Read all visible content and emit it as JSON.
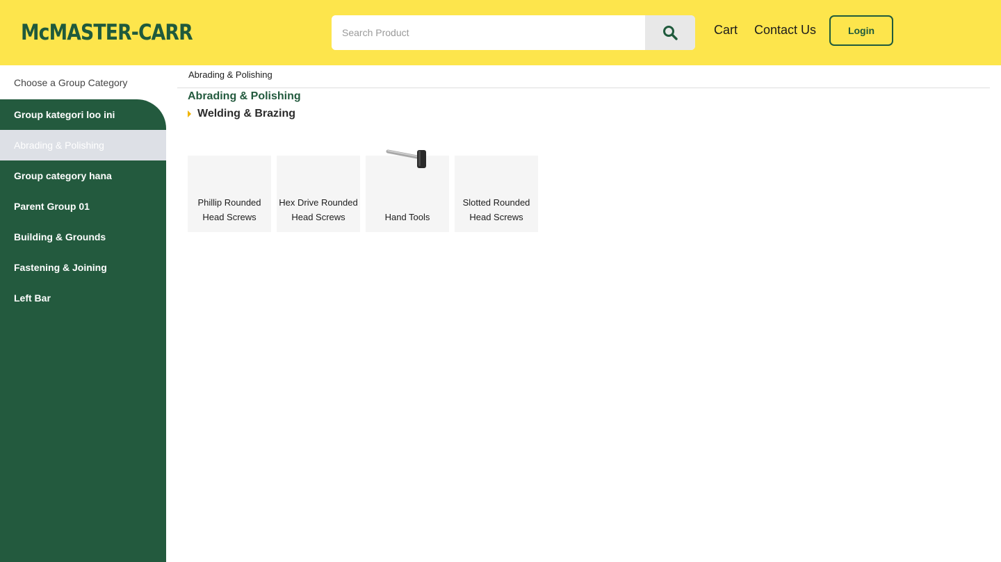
{
  "header": {
    "logo": "McMASTER-CARR",
    "search_placeholder": "Search Product",
    "search_icon": "search-icon",
    "cart_label": "Cart",
    "contact_label": "Contact Us",
    "login_label": "Login"
  },
  "sidebar": {
    "title": "Choose a Group Category",
    "items": [
      {
        "label": "Group kategori loo ini"
      },
      {
        "label": "Abrading & Polishing",
        "active": true
      },
      {
        "label": "Group category hana"
      },
      {
        "label": "Parent Group 01"
      },
      {
        "label": "Building & Grounds"
      },
      {
        "label": "Fastening & Joining"
      },
      {
        "label": "Left Bar"
      }
    ]
  },
  "main": {
    "breadcrumb": "Abrading & Polishing",
    "category_title": "Abrading & Polishing",
    "subcategory": "Welding & Brazing",
    "products": [
      {
        "line1": "Phillip Rounded",
        "line2": "Head Screws"
      },
      {
        "line1": "Hex Drive Rounded",
        "line2": "Head Screws"
      },
      {
        "line1": "",
        "line2": "Hand Tools",
        "icon": "hammer-icon"
      },
      {
        "line1": "Slotted Rounded",
        "line2": "Head Screws"
      }
    ]
  },
  "colors": {
    "header_bg": "#fde54c",
    "brand_green": "#235a3e",
    "active_item_bg": "#dde0e6",
    "accent_arrow": "#f0b400"
  }
}
